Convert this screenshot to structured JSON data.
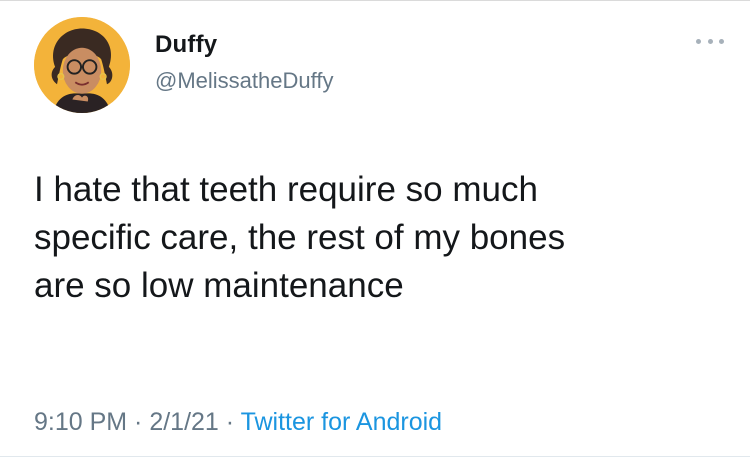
{
  "author": {
    "display_name": "Duffy",
    "handle": "@MelissatheDuffy",
    "avatar_icon": "cartoon-woman-avatar",
    "avatar_bg": "#f3b33a"
  },
  "tweet": {
    "text": "I hate that teeth require so much\nspecific care, the rest of my bones\nare so low maintenance",
    "time": "9:10 PM",
    "separator": " · ",
    "date": "2/1/21",
    "source": "Twitter for Android"
  },
  "menu": {
    "icon": "more-horizontal-icon"
  },
  "colors": {
    "text": "#14171a",
    "muted": "#657786",
    "link": "#1b95e0"
  }
}
